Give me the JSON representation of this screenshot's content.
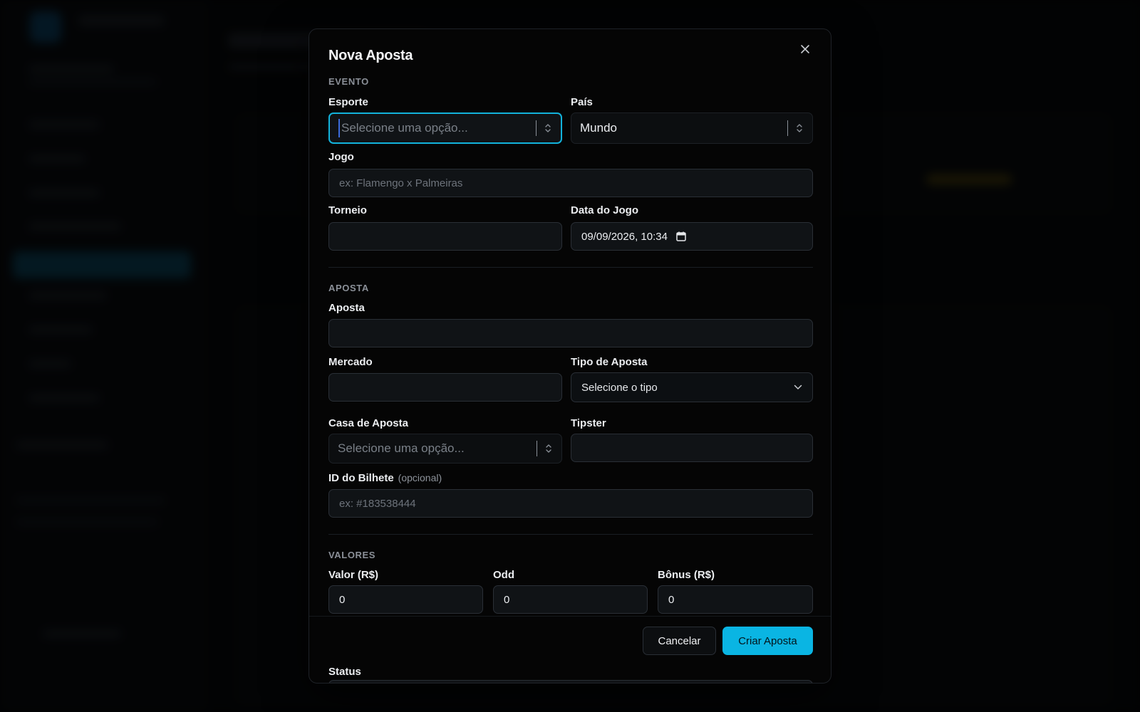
{
  "background_app": {
    "name": "Green Stats"
  },
  "modal": {
    "title": "Nova Aposta",
    "sections": {
      "evento": "EVENTO",
      "aposta": "APOSTA",
      "valores": "VALORES"
    },
    "fields": {
      "esporte": {
        "label": "Esporte",
        "placeholder": "Selecione uma opção..."
      },
      "pais": {
        "label": "País",
        "value": "Mundo"
      },
      "jogo": {
        "label": "Jogo",
        "placeholder": "ex: Flamengo x Palmeiras"
      },
      "torneio": {
        "label": "Torneio",
        "value": ""
      },
      "data_jogo": {
        "label": "Data do Jogo",
        "value": "09/09/2026, 10:34"
      },
      "aposta": {
        "label": "Aposta",
        "value": ""
      },
      "mercado": {
        "label": "Mercado",
        "value": ""
      },
      "tipo_aposta": {
        "label": "Tipo de Aposta",
        "value": "Selecione o tipo"
      },
      "casa_aposta": {
        "label": "Casa de Aposta",
        "placeholder": "Selecione uma opção..."
      },
      "tipster": {
        "label": "Tipster",
        "value": ""
      },
      "id_bilhete": {
        "label": "ID do Bilhete",
        "optional": "(opcional)",
        "placeholder": "ex: #183538444"
      },
      "valor": {
        "label": "Valor (R$)",
        "value": "0"
      },
      "odd": {
        "label": "Odd",
        "value": "0"
      },
      "bonus": {
        "label": "Bônus (R$)",
        "value": "0"
      },
      "status": {
        "label": "Status"
      }
    },
    "buttons": {
      "cancel": "Cancelar",
      "create": "Criar Aposta"
    }
  },
  "colors": {
    "accent": "#0ab5e3",
    "focus_ring": "#12b3dc"
  }
}
